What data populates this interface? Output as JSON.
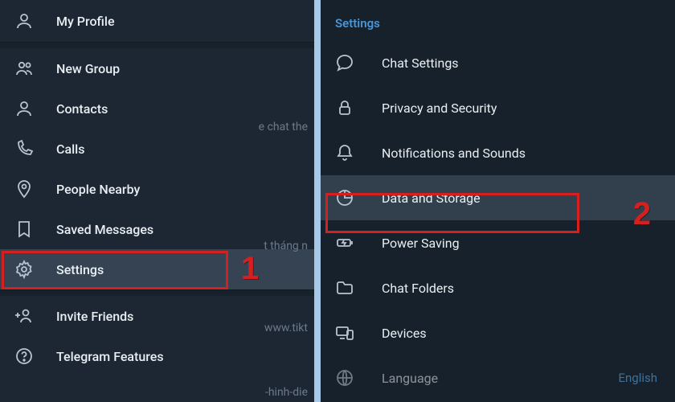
{
  "leftMenu": {
    "items": [
      {
        "label": "My Profile"
      },
      {
        "label": "New Group"
      },
      {
        "label": "Contacts"
      },
      {
        "label": "Calls"
      },
      {
        "label": "People Nearby"
      },
      {
        "label": "Saved Messages"
      },
      {
        "label": "Settings"
      },
      {
        "label": "Invite Friends"
      },
      {
        "label": "Telegram Features"
      }
    ]
  },
  "rightPanel": {
    "heading": "Settings",
    "items": [
      {
        "label": "Chat Settings"
      },
      {
        "label": "Privacy and Security"
      },
      {
        "label": "Notifications and Sounds"
      },
      {
        "label": "Data and Storage"
      },
      {
        "label": "Power Saving"
      },
      {
        "label": "Chat Folders"
      },
      {
        "label": "Devices"
      },
      {
        "label": "Language",
        "value": "English"
      }
    ]
  },
  "annotations": {
    "step1": "1",
    "step2": "2"
  },
  "bgFragments": {
    "a": "e chat the",
    "b": "t tháng n",
    "c": "www.tikt",
    "d": "-hinh-die"
  }
}
